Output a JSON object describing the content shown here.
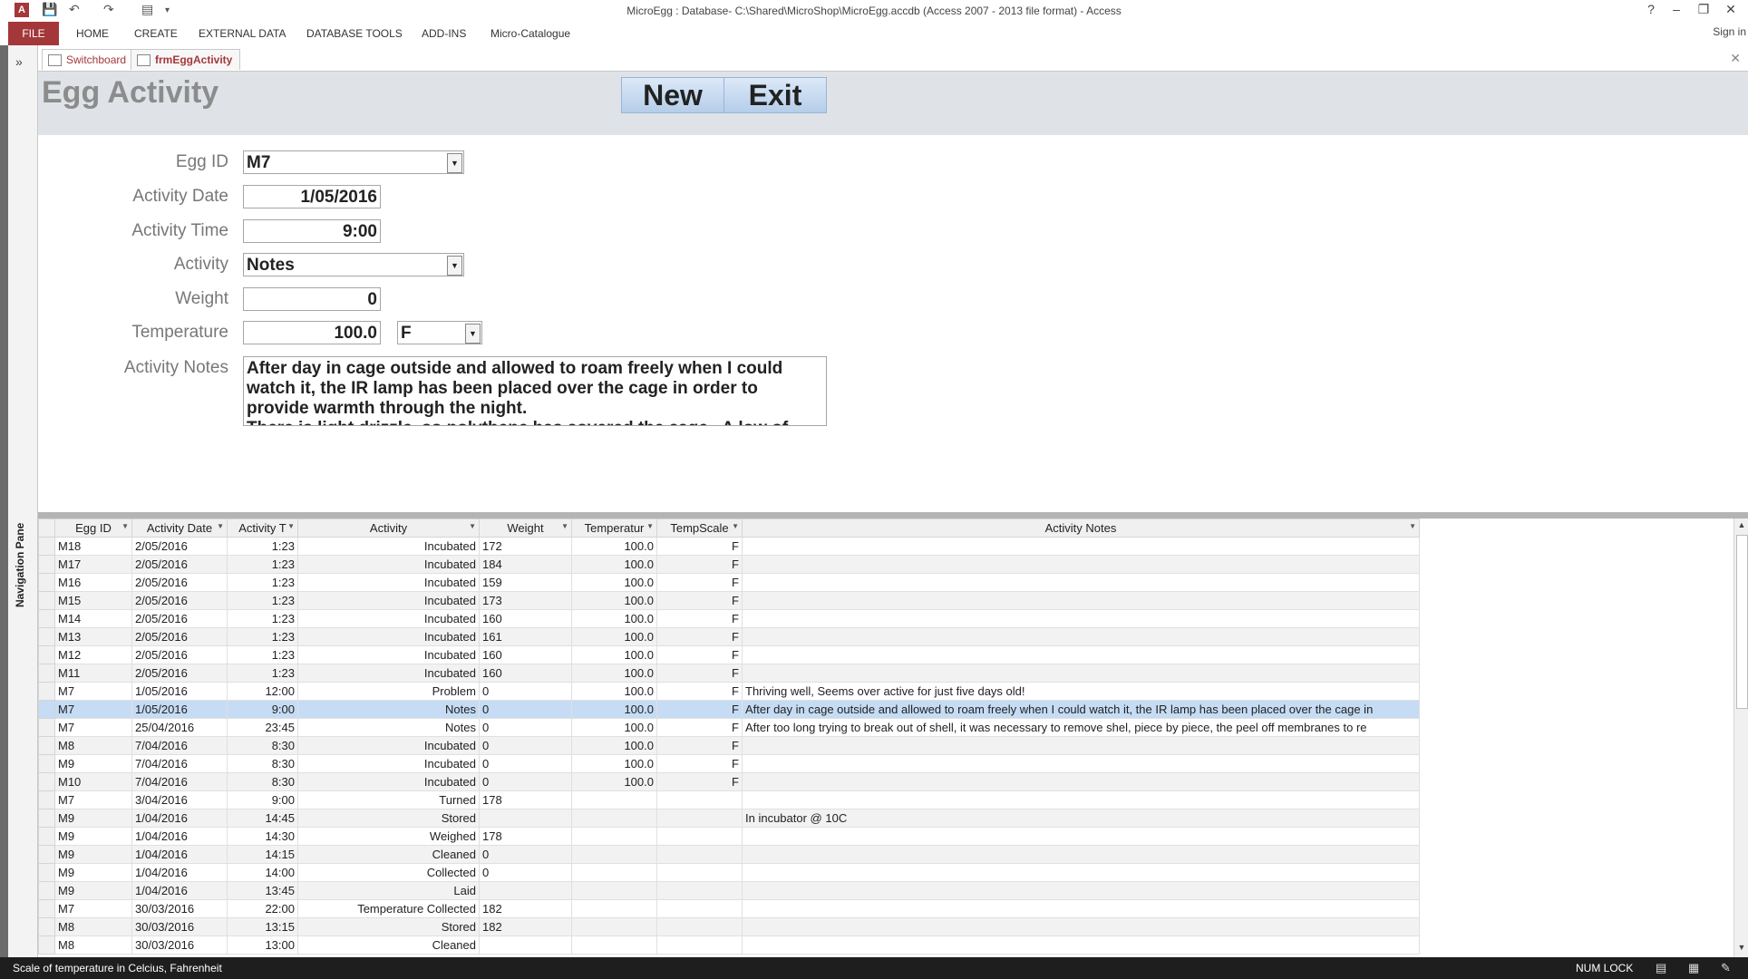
{
  "window": {
    "title": "MicroEgg : Database- C:\\Shared\\MicroShop\\MicroEgg.accdb (Access 2007 - 2013 file format) - Access",
    "app_icon": "A",
    "help": "?",
    "minimize": "–",
    "restore": "❐",
    "close": "✕"
  },
  "ribbon": {
    "tabs": [
      "FILE",
      "HOME",
      "CREATE",
      "EXTERNAL DATA",
      "DATABASE TOOLS",
      "ADD-INS",
      "Micro-Catalogue"
    ],
    "sign_in": "Sign in"
  },
  "nav_pane": {
    "label": "Navigation Pane",
    "toggle": "»"
  },
  "doc_tabs": [
    "Switchboard",
    "frmEggActivity"
  ],
  "form": {
    "title": "Egg Activity",
    "new_button": "New",
    "exit_button": "Exit",
    "labels": {
      "egg_id": "Egg ID",
      "activity_date": "Activity Date",
      "activity_time": "Activity Time",
      "activity": "Activity",
      "weight": "Weight",
      "temperature": "Temperature",
      "activity_notes": "Activity Notes"
    },
    "values": {
      "egg_id": "M7",
      "activity_date": "1/05/2016",
      "activity_time": "9:00",
      "activity": "Notes",
      "weight": "0",
      "temperature": "100.0",
      "temp_scale": "F",
      "activity_notes": "After day in cage outside and allowed to roam freely when I could watch it, the IR lamp has been placed over the cage in order to provide warmth through the night.\nThere is light drizzle, so polythene has covered the cage.  A low of"
    }
  },
  "datasheet": {
    "columns": [
      "Egg ID",
      "Activity Date",
      "Activity T",
      "Activity",
      "Weight",
      "Temperatur",
      "TempScale",
      "Activity Notes"
    ],
    "current_row": 9,
    "rows": [
      [
        "M18",
        "2/05/2016",
        "1:23",
        "Incubated",
        "172",
        "100.0",
        "F",
        ""
      ],
      [
        "M17",
        "2/05/2016",
        "1:23",
        "Incubated",
        "184",
        "100.0",
        "F",
        ""
      ],
      [
        "M16",
        "2/05/2016",
        "1:23",
        "Incubated",
        "159",
        "100.0",
        "F",
        ""
      ],
      [
        "M15",
        "2/05/2016",
        "1:23",
        "Incubated",
        "173",
        "100.0",
        "F",
        ""
      ],
      [
        "M14",
        "2/05/2016",
        "1:23",
        "Incubated",
        "160",
        "100.0",
        "F",
        ""
      ],
      [
        "M13",
        "2/05/2016",
        "1:23",
        "Incubated",
        "161",
        "100.0",
        "F",
        ""
      ],
      [
        "M12",
        "2/05/2016",
        "1:23",
        "Incubated",
        "160",
        "100.0",
        "F",
        ""
      ],
      [
        "M11",
        "2/05/2016",
        "1:23",
        "Incubated",
        "160",
        "100.0",
        "F",
        ""
      ],
      [
        "M7",
        "1/05/2016",
        "12:00",
        "Problem",
        "0",
        "100.0",
        "F",
        "Thriving well, Seems over active for just five days old!"
      ],
      [
        "M7",
        "1/05/2016",
        "9:00",
        "Notes",
        "0",
        "100.0",
        "F",
        "After day in cage outside and allowed to roam freely when I could watch it, the IR lamp has been placed over the cage in"
      ],
      [
        "M7",
        "25/04/2016",
        "23:45",
        "Notes",
        "0",
        "100.0",
        "F",
        "After too long trying to break out of shell, it was necessary to remove shel, piece by piece, the peel off membranes to re"
      ],
      [
        "M8",
        "7/04/2016",
        "8:30",
        "Incubated",
        "0",
        "100.0",
        "F",
        ""
      ],
      [
        "M9",
        "7/04/2016",
        "8:30",
        "Incubated",
        "0",
        "100.0",
        "F",
        ""
      ],
      [
        "M10",
        "7/04/2016",
        "8:30",
        "Incubated",
        "0",
        "100.0",
        "F",
        ""
      ],
      [
        "M7",
        "3/04/2016",
        "9:00",
        "Turned",
        "178",
        "",
        "",
        ""
      ],
      [
        "M9",
        "1/04/2016",
        "14:45",
        "Stored",
        "",
        "",
        "",
        "In incubator @ 10C"
      ],
      [
        "M9",
        "1/04/2016",
        "14:30",
        "Weighed",
        "178",
        "",
        "",
        ""
      ],
      [
        "M9",
        "1/04/2016",
        "14:15",
        "Cleaned",
        "0",
        "",
        "",
        ""
      ],
      [
        "M9",
        "1/04/2016",
        "14:00",
        "Collected",
        "0",
        "",
        "",
        ""
      ],
      [
        "M9",
        "1/04/2016",
        "13:45",
        "Laid",
        "",
        "",
        "",
        ""
      ],
      [
        "M7",
        "30/03/2016",
        "22:00",
        "Temperature Collected",
        "182",
        "",
        "",
        ""
      ],
      [
        "M8",
        "30/03/2016",
        "13:15",
        "Stored",
        "182",
        "",
        "",
        ""
      ],
      [
        "M8",
        "30/03/2016",
        "13:00",
        "Cleaned",
        "",
        "",
        "",
        ""
      ]
    ]
  },
  "status": {
    "text": "Scale of temperature in Celcius, Fahrenheit",
    "num_lock": "NUM LOCK"
  },
  "colors": {
    "file_tab": "#a4373a",
    "selection": "#c5dcf4",
    "header_band": "#dfe3e8"
  }
}
